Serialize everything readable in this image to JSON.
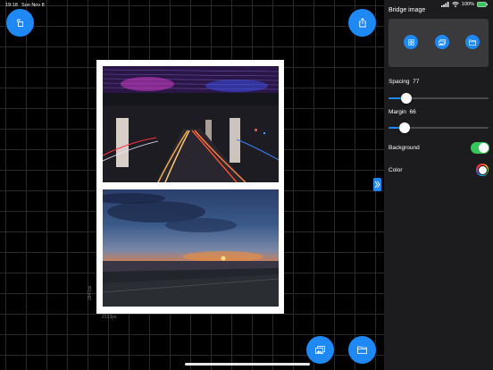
{
  "status": {
    "time": "19:18",
    "date": "Sun Nov 8",
    "battery": "100%"
  },
  "canvas": {
    "width_label": "2133px",
    "height_label": "2847px"
  },
  "panel": {
    "title": "Bridge image",
    "spacing_label": "Spacing",
    "spacing_value": "77",
    "spacing_fraction": 0.18,
    "margin_label": "Margin",
    "margin_value": "66",
    "margin_fraction": 0.16,
    "background_label": "Background",
    "background_on": true,
    "color_label": "Color"
  },
  "colors": {
    "accent": "#1e88f5",
    "toggle": "#34c759",
    "panel": "#1c1c1e"
  },
  "icons": [
    "rotate-icon",
    "share-icon",
    "collapse-panel-icon",
    "grid-icon",
    "photo-icon",
    "folder-icon"
  ]
}
